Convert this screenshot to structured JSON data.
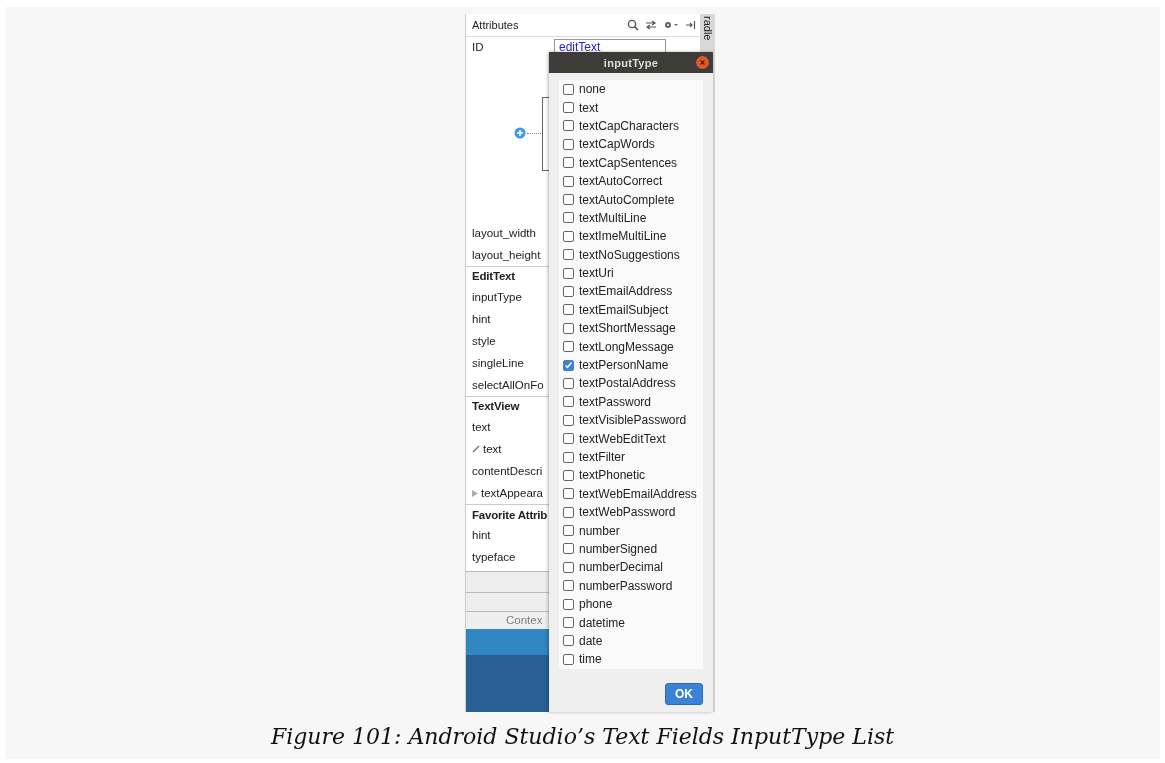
{
  "attributes_panel": {
    "title": "Attributes",
    "id_label": "ID",
    "id_value": "editText",
    "rows": [
      {
        "kind": "attr",
        "label": "layout_width"
      },
      {
        "kind": "attr",
        "label": "layout_height"
      },
      {
        "kind": "section",
        "label": "EditText"
      },
      {
        "kind": "attr",
        "label": "inputType"
      },
      {
        "kind": "attr",
        "label": "hint"
      },
      {
        "kind": "attr",
        "label": "style"
      },
      {
        "kind": "attr",
        "label": "singleLine"
      },
      {
        "kind": "attr",
        "label": "selectAllOnFo"
      },
      {
        "kind": "section",
        "label": "TextView"
      },
      {
        "kind": "attr",
        "label": "text"
      },
      {
        "kind": "edited",
        "label": "text"
      },
      {
        "kind": "attr",
        "label": "contentDescri"
      },
      {
        "kind": "collapsed",
        "label": "textAppeara"
      },
      {
        "kind": "section",
        "label": "Favorite Attrib"
      },
      {
        "kind": "attr",
        "label": "hint"
      },
      {
        "kind": "attr",
        "label": "typeface"
      }
    ]
  },
  "side_tab": "radle",
  "bottom_label": "Contex",
  "dialog": {
    "title": "inputType",
    "ok": "OK",
    "options": [
      {
        "label": "none",
        "checked": false
      },
      {
        "label": "text",
        "checked": false
      },
      {
        "label": "textCapCharacters",
        "checked": false
      },
      {
        "label": "textCapWords",
        "checked": false
      },
      {
        "label": "textCapSentences",
        "checked": false
      },
      {
        "label": "textAutoCorrect",
        "checked": false
      },
      {
        "label": "textAutoComplete",
        "checked": false
      },
      {
        "label": "textMultiLine",
        "checked": false
      },
      {
        "label": "textImeMultiLine",
        "checked": false
      },
      {
        "label": "textNoSuggestions",
        "checked": false
      },
      {
        "label": "textUri",
        "checked": false
      },
      {
        "label": "textEmailAddress",
        "checked": false
      },
      {
        "label": "textEmailSubject",
        "checked": false
      },
      {
        "label": "textShortMessage",
        "checked": false
      },
      {
        "label": "textLongMessage",
        "checked": false
      },
      {
        "label": "textPersonName",
        "checked": true
      },
      {
        "label": "textPostalAddress",
        "checked": false
      },
      {
        "label": "textPassword",
        "checked": false
      },
      {
        "label": "textVisiblePassword",
        "checked": false
      },
      {
        "label": "textWebEditText",
        "checked": false
      },
      {
        "label": "textFilter",
        "checked": false
      },
      {
        "label": "textPhonetic",
        "checked": false
      },
      {
        "label": "textWebEmailAddress",
        "checked": false
      },
      {
        "label": "textWebPassword",
        "checked": false
      },
      {
        "label": "number",
        "checked": false
      },
      {
        "label": "numberSigned",
        "checked": false
      },
      {
        "label": "numberDecimal",
        "checked": false
      },
      {
        "label": "numberPassword",
        "checked": false
      },
      {
        "label": "phone",
        "checked": false
      },
      {
        "label": "datetime",
        "checked": false
      },
      {
        "label": "date",
        "checked": false
      },
      {
        "label": "time",
        "checked": false
      }
    ]
  },
  "caption": "Figure 101: Android Studio’s Text Fields InputType List"
}
